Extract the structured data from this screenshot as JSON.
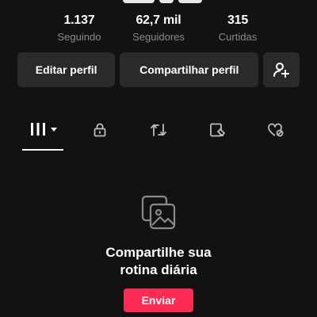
{
  "profile": {
    "stats": [
      {
        "value": "1.137",
        "label": "Seguindo"
      },
      {
        "value": "62,7 mil",
        "label": "Seguidores"
      },
      {
        "value": "315",
        "label": "Curtidas"
      }
    ]
  },
  "actions": {
    "edit_label": "Editar perfil",
    "share_label": "Compartilhar perfil",
    "add_friend_icon": "add-user-icon"
  },
  "tabs": [
    {
      "icon": "grid-icon",
      "active": true,
      "has_dropdown": true
    },
    {
      "icon": "lock-icon",
      "active": false
    },
    {
      "icon": "repost-icon",
      "active": false
    },
    {
      "icon": "saved-icon",
      "active": false
    },
    {
      "icon": "liked-icon",
      "active": false
    }
  ],
  "empty_state": {
    "icon": "photos-icon",
    "title": "Compartilhe sua rotina diária",
    "button_label": "Enviar"
  },
  "colors": {
    "background": "#121212",
    "button_bg": "#2a2a2a",
    "accent": "#fe2c55",
    "muted_text": "#8a8a8a"
  }
}
